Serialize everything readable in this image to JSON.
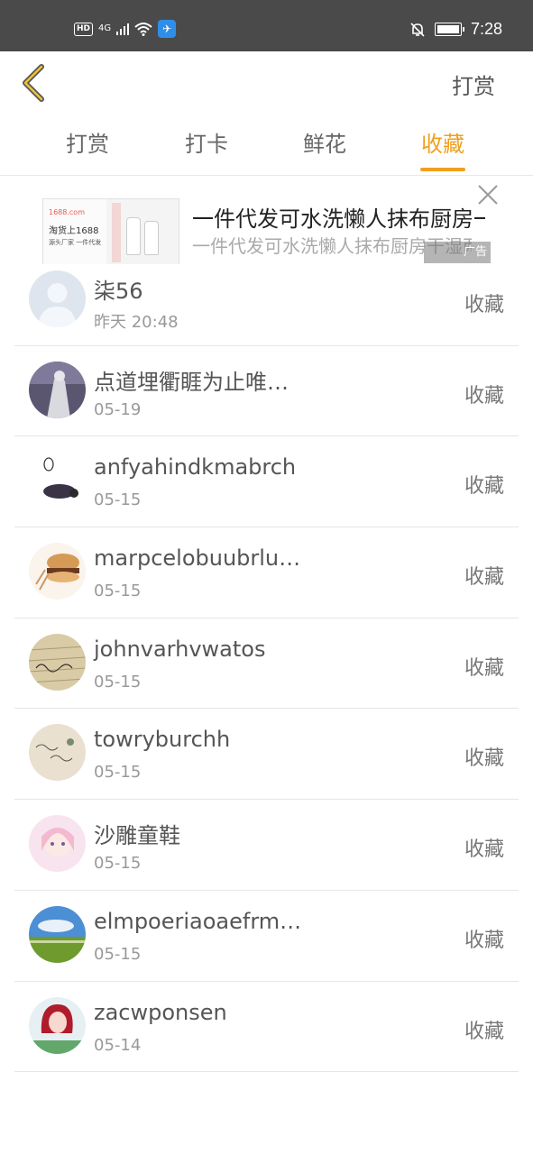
{
  "status_bar": {
    "hd": "HD",
    "network": "4G",
    "time": "7:28"
  },
  "header": {
    "action_label": "打赏"
  },
  "tabs": [
    {
      "label": "打赏",
      "active": false
    },
    {
      "label": "打卡",
      "active": false
    },
    {
      "label": "鲜花",
      "active": false
    },
    {
      "label": "收藏",
      "active": true
    }
  ],
  "ad": {
    "image_brand": "1688.com",
    "image_title": "淘货上1688",
    "image_sub": "源头厂家 一件代发",
    "title": "一件代发可水洗懒人抹布厨房一次性",
    "description": "一件代发可水洗懒人抹布厨房干湿两用清洁去油污",
    "badge": "广告"
  },
  "list": [
    {
      "name": "柒56",
      "time": "昨天 20:48",
      "action": "收藏"
    },
    {
      "name": "点道埋衢睚为止唯…",
      "time": "05-19",
      "action": "收藏"
    },
    {
      "name": "anfyahindkmabrch",
      "time": "05-15",
      "action": "收藏"
    },
    {
      "name": "marpcelobuubrlu…",
      "time": "05-15",
      "action": "收藏"
    },
    {
      "name": "johnvarhvwatos",
      "time": "05-15",
      "action": "收藏"
    },
    {
      "name": "towryburchh",
      "time": "05-15",
      "action": "收藏"
    },
    {
      "name": "沙雕童鞋",
      "time": "05-15",
      "action": "收藏"
    },
    {
      "name": "elmpoeriaoaefrm…",
      "time": "05-15",
      "action": "收藏"
    },
    {
      "name": "zacwponsen",
      "time": "05-14",
      "action": "收藏"
    }
  ],
  "colors": {
    "accent": "#f0a020",
    "status_bar": "#4a4a4a",
    "divider": "#e6e6e6"
  },
  "icons": {
    "back": "chevron-left-icon",
    "close": "close-icon"
  }
}
